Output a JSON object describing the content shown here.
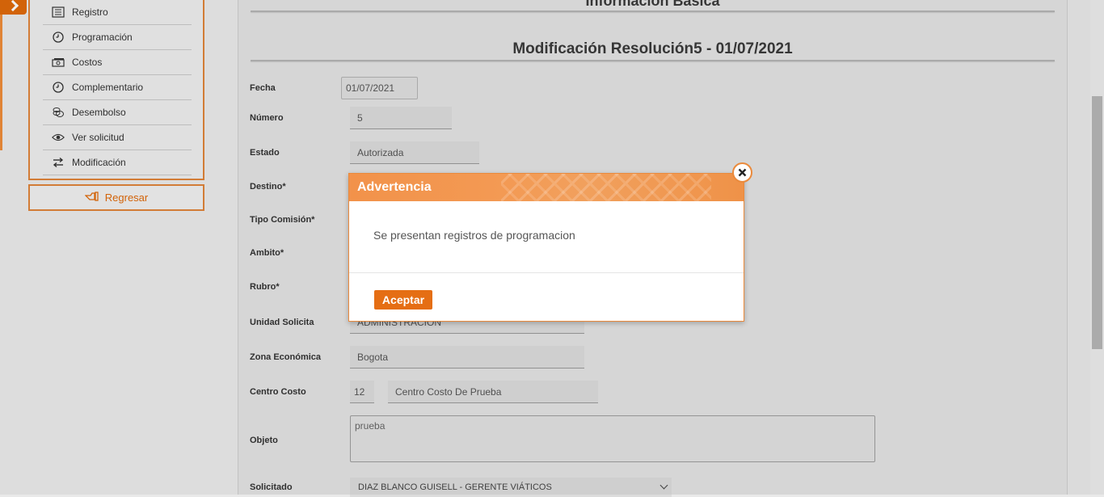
{
  "sidebar": {
    "menu": [
      {
        "label": "Registro",
        "icon": "list-icon"
      },
      {
        "label": "Programación",
        "icon": "clock-icon"
      },
      {
        "label": "Costos",
        "icon": "cash-icon"
      },
      {
        "label": "Complementario",
        "icon": "clock-icon"
      },
      {
        "label": "Desembolso",
        "icon": "coins-icon"
      },
      {
        "label": "Ver solicitud",
        "icon": "eye-icon"
      },
      {
        "label": "Modificación",
        "icon": "swap-icon"
      }
    ],
    "back_label": "Regresar"
  },
  "header": {
    "section_title": "Información Básica",
    "subtitle": "Modificación Resolución5 - 01/07/2021"
  },
  "form": {
    "fecha": {
      "label": "Fecha",
      "value": "01/07/2021"
    },
    "numero": {
      "label": "Número",
      "value": "5"
    },
    "estado": {
      "label": "Estado",
      "value": "Autorizada"
    },
    "destino": {
      "label": "Destino*"
    },
    "tipo_comision": {
      "label": "Tipo Comisión*"
    },
    "ambito": {
      "label": "Ambito*"
    },
    "rubro": {
      "label": "Rubro*"
    },
    "unidad_solicita": {
      "label": "Unidad Solicita",
      "value": "ADMINISTRACION"
    },
    "zona_economica": {
      "label": "Zona Económica",
      "value": "Bogota"
    },
    "centro_costo": {
      "label": "Centro Costo",
      "code": "12",
      "value": "Centro Costo De Prueba"
    },
    "objeto": {
      "label": "Objeto",
      "value": "prueba"
    },
    "solicitado": {
      "label": "Solicitado",
      "value": "DIAZ BLANCO GUISELL - GERENTE VIÁTICOS"
    }
  },
  "dialog": {
    "title": "Advertencia",
    "message": "Se presentan registros de programacion",
    "accept_label": "Aceptar"
  },
  "colors": {
    "accent": "#e56e14",
    "dialog_header": "#f39a54"
  }
}
